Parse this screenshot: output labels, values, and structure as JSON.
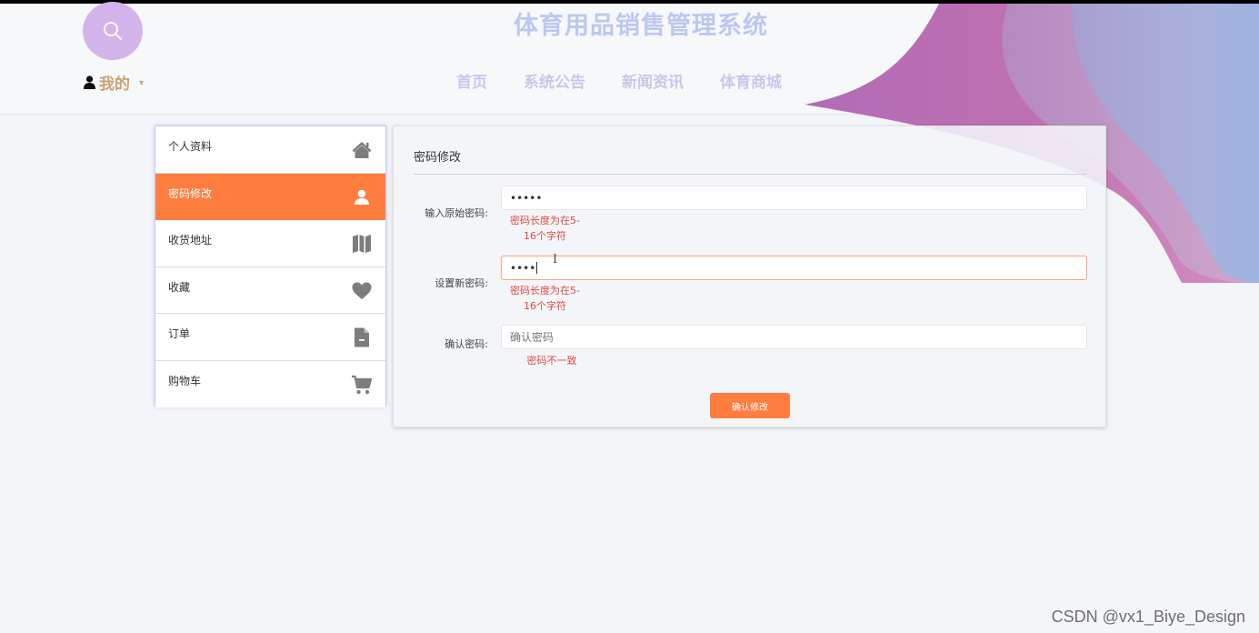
{
  "site": {
    "title": "体育用品销售管理系统"
  },
  "header": {
    "search_icon": "search-icon",
    "user_menu": {
      "icon": "user-icon",
      "label": "我的",
      "caret": "▾"
    },
    "nav": [
      {
        "label": "首页"
      },
      {
        "label": "系统公告"
      },
      {
        "label": "新闻资讯"
      },
      {
        "label": "体育商城"
      }
    ]
  },
  "sidebar": {
    "items": [
      {
        "label": "个人资料",
        "icon": "home-icon",
        "active": false
      },
      {
        "label": "密码修改",
        "icon": "user-icon",
        "active": true
      },
      {
        "label": "收货地址",
        "icon": "map-icon",
        "active": false
      },
      {
        "label": "收藏",
        "icon": "heart-icon",
        "active": false
      },
      {
        "label": "订单",
        "icon": "document-icon",
        "active": false
      },
      {
        "label": "购物车",
        "icon": "cart-icon",
        "active": false
      }
    ]
  },
  "form": {
    "title": "密码修改",
    "old_password": {
      "label": "输入原始密码:",
      "value": "•••••",
      "error_line1": "密码长度为在5-",
      "error_line2": "16个字符"
    },
    "new_password": {
      "label": "设置新密码:",
      "value": "••••",
      "error_line1": "密码长度为在5-",
      "error_line2": "16个字符"
    },
    "confirm_password": {
      "label": "确认密码:",
      "placeholder": "确认密码",
      "error": "密码不一致"
    },
    "submit_label": "确认修改"
  },
  "watermark": "CSDN @vx1_Biye_Design",
  "colors": {
    "accent": "#ff7d3f",
    "error": "#e04a43",
    "title": "#bcc8ef",
    "nav": "#c6c8ec",
    "search_circle": "#d3b4ea",
    "user_label": "#c9a275"
  }
}
